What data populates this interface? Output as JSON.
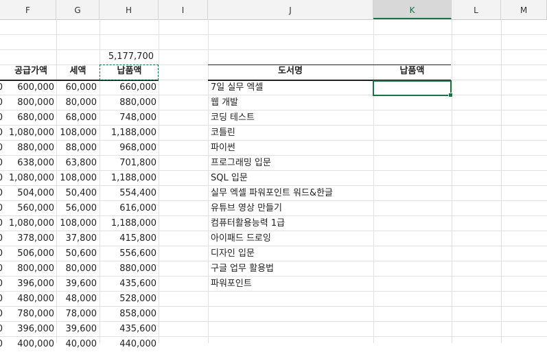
{
  "columns": [
    "F",
    "G",
    "H",
    "I",
    "J",
    "K",
    "L",
    "M"
  ],
  "selected_column": "K",
  "sum_value": "5,177,700",
  "left_table": {
    "headers": {
      "supply": "공급가액",
      "tax": "세액",
      "payment": "납품액"
    },
    "rows": [
      {
        "supply": "600,000",
        "tax": "60,000",
        "payment": "660,000"
      },
      {
        "supply": "800,000",
        "tax": "80,000",
        "payment": "880,000"
      },
      {
        "supply": "680,000",
        "tax": "68,000",
        "payment": "748,000"
      },
      {
        "supply": "1,080,000",
        "tax": "108,000",
        "payment": "1,188,000"
      },
      {
        "supply": "880,000",
        "tax": "88,000",
        "payment": "968,000"
      },
      {
        "supply": "638,000",
        "tax": "63,800",
        "payment": "701,800"
      },
      {
        "supply": "1,080,000",
        "tax": "108,000",
        "payment": "1,188,000"
      },
      {
        "supply": "504,000",
        "tax": "50,400",
        "payment": "554,400"
      },
      {
        "supply": "560,000",
        "tax": "56,000",
        "payment": "616,000"
      },
      {
        "supply": "1,080,000",
        "tax": "108,000",
        "payment": "1,188,000"
      },
      {
        "supply": "378,000",
        "tax": "37,800",
        "payment": "415,800"
      },
      {
        "supply": "506,000",
        "tax": "50,600",
        "payment": "556,600"
      },
      {
        "supply": "800,000",
        "tax": "80,000",
        "payment": "880,000"
      },
      {
        "supply": "396,000",
        "tax": "39,600",
        "payment": "435,600"
      },
      {
        "supply": "480,000",
        "tax": "48,000",
        "payment": "528,000"
      },
      {
        "supply": "780,000",
        "tax": "78,000",
        "payment": "858,000"
      },
      {
        "supply": "396,000",
        "tax": "39,600",
        "payment": "435,600"
      },
      {
        "supply": "400,000",
        "tax": "40,000",
        "payment": "440,000"
      }
    ]
  },
  "right_table": {
    "headers": {
      "book": "도서명",
      "payment": "납품액"
    },
    "books": [
      "7일 실무 엑셀",
      "웹 개발",
      "코딩 테스트",
      "코틀린",
      "파이썬",
      "프로그래밍 입문",
      "SQL 입문",
      "실무 엑셀 파워포인트 워드&한글",
      "유튜브 영상 만들기",
      "컴퓨터활용능력 1급",
      "아이패드 드로잉",
      "디자인 입문",
      "구글 업무 활용법",
      "파워포인트"
    ]
  }
}
